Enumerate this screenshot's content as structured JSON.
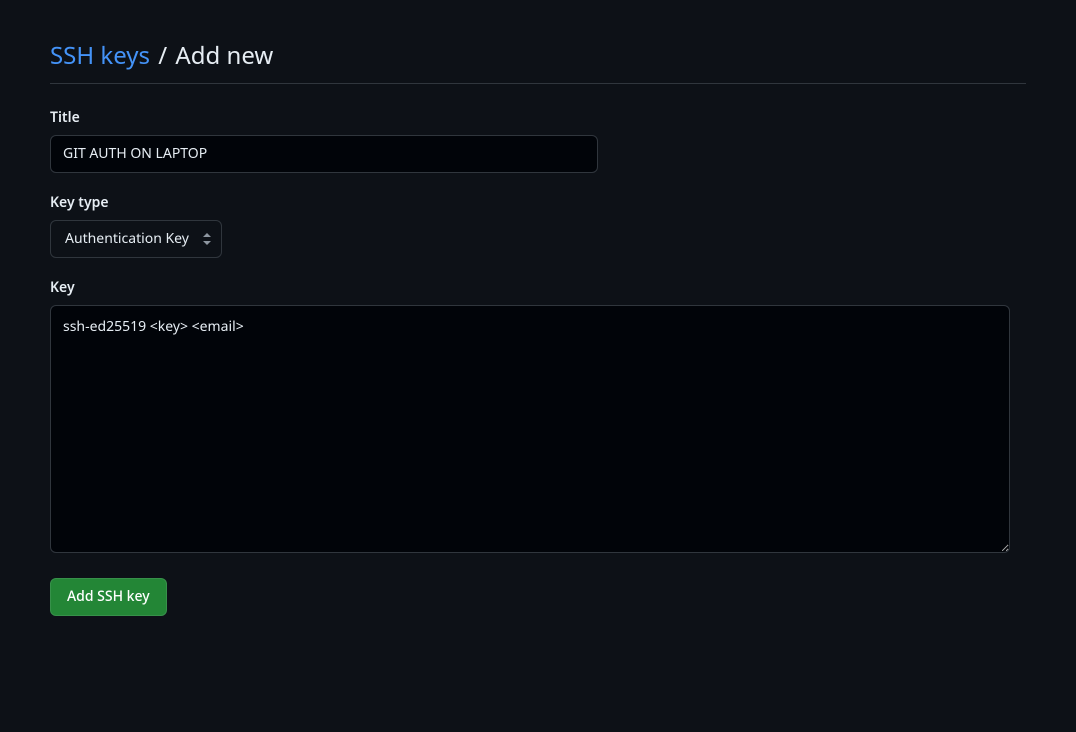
{
  "breadcrumb": {
    "parent_label": "SSH keys",
    "separator": "/",
    "current_label": "Add new"
  },
  "form": {
    "title": {
      "label": "Title",
      "value": "GIT AUTH ON LAPTOP"
    },
    "key_type": {
      "label": "Key type",
      "selected": "Authentication Key"
    },
    "key": {
      "label": "Key",
      "value": "ssh-ed25519 <key> <email>"
    },
    "submit_label": "Add SSH key"
  }
}
